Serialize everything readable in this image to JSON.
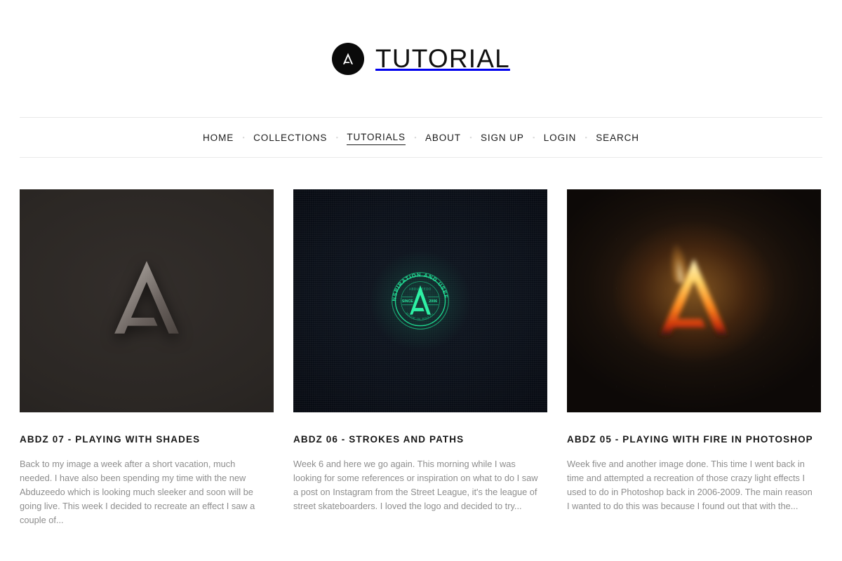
{
  "site": {
    "logo_icon": "abduzeedo-a-logo-icon",
    "title": "TUTORIAL"
  },
  "nav": {
    "separator": "▪",
    "items": [
      {
        "label": "HOME",
        "active": false
      },
      {
        "label": "COLLECTIONS",
        "active": false
      },
      {
        "label": "TUTORIALS",
        "active": true
      },
      {
        "label": "ABOUT",
        "active": false
      },
      {
        "label": "SIGN UP",
        "active": false
      },
      {
        "label": "LOGIN",
        "active": false
      },
      {
        "label": "SEARCH",
        "active": false
      }
    ]
  },
  "cards": [
    {
      "thumb_alt": "3d-metallic-a-logo-on-dark-grey",
      "title": "ABDZ 07 - PLAYING WITH SHADES",
      "excerpt": "Back to my image a week after a short vacation, much needed. I have also been spending my time with the new Abduzeedo which is looking much sleeker and soon will be going live. This week I decided to recreate an effect I saw a couple of..."
    },
    {
      "thumb_alt": "green-circular-badge-on-dark-fabric",
      "title": "ABDZ 06 - STROKES AND PATHS",
      "excerpt": "Week 6 and here we go again. This morning while I was looking for some references or inspiration on what to do I saw a post on Instagram from the Street League, it's the league of street skateboarders. I loved the logo and decided to try...",
      "badge": {
        "arc_top": "DESIGN INSPIRATION AND USEFUL STUFF",
        "small_top": "ABDUZEEDO",
        "left": "SINCE",
        "right": "2006",
        "arc_bottom": "MADE IN BRAZIL"
      }
    },
    {
      "thumb_alt": "burning-fire-a-logo-on-dark-background",
      "title": "ABDZ 05 - PLAYING WITH FIRE IN PHOTOSHOP",
      "excerpt": "Week five and another image done. This time I went back in time and attempted a recreation of those crazy light effects I used to do in Photoshop back in 2006-2009. The main reason I wanted to do this was because I found out that with the..."
    }
  ],
  "colors": {
    "page_background": "#ffffff",
    "text_primary": "#161616",
    "text_muted": "#8d8d8d",
    "rule": "#e9e9e9",
    "badge_green": "#1ed18c",
    "fire_orange": "#ff8c1a"
  }
}
